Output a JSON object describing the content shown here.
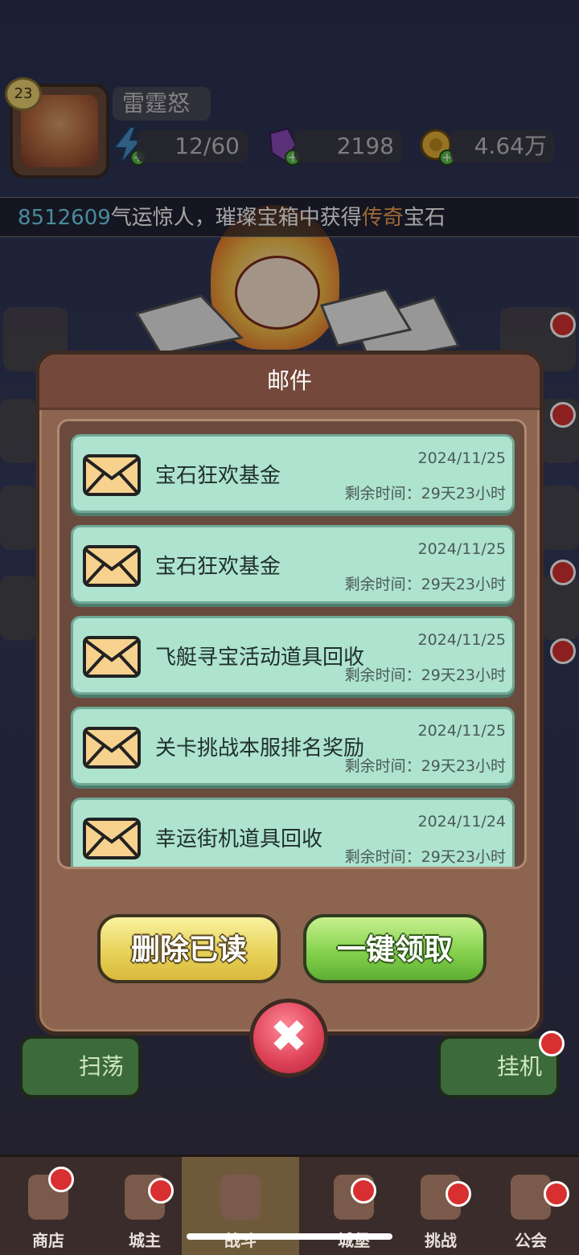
{
  "player": {
    "name": "雷霆怒",
    "level": "23",
    "stamina": "12/60",
    "gems": "2198",
    "gold": "4.64万"
  },
  "ticker": {
    "player_id": "8512609",
    "text_before": "气运惊人，璀璨宝箱中获得",
    "highlight": "传奇",
    "text_after": "宝石"
  },
  "dialog": {
    "title": "邮件",
    "mails": [
      {
        "title": "宝石狂欢基金",
        "date": "2024/11/25",
        "remaining": "剩余时间：29天23小时"
      },
      {
        "title": "宝石狂欢基金",
        "date": "2024/11/25",
        "remaining": "剩余时间：29天23小时"
      },
      {
        "title": "飞艇寻宝活动道具回收",
        "date": "2024/11/25",
        "remaining": "剩余时间：29天23小时"
      },
      {
        "title": "关卡挑战本服排名奖励",
        "date": "2024/11/25",
        "remaining": "剩余时间：29天23小时"
      },
      {
        "title": "幸运街机道具回收",
        "date": "2024/11/24",
        "remaining": "剩余时间：29天23小时"
      }
    ],
    "delete_read_label": "删除已读",
    "claim_all_label": "一键领取"
  },
  "quick_actions": {
    "sweep": "扫荡",
    "idle": "挂机"
  },
  "nav": [
    {
      "label": "商店"
    },
    {
      "label": "城主"
    },
    {
      "label": "战斗"
    },
    {
      "label": "城堡"
    },
    {
      "label": "挑战"
    },
    {
      "label": "公会"
    }
  ],
  "colors": {
    "mail_item_bg": "#aee3cf",
    "dialog_bg": "#8c6450",
    "claim_button": "#86d24e",
    "delete_button": "#e8d25a",
    "close_button": "#e0455a",
    "ticker_id": "#6fd6f0",
    "ticker_highlight": "#f0a050"
  }
}
